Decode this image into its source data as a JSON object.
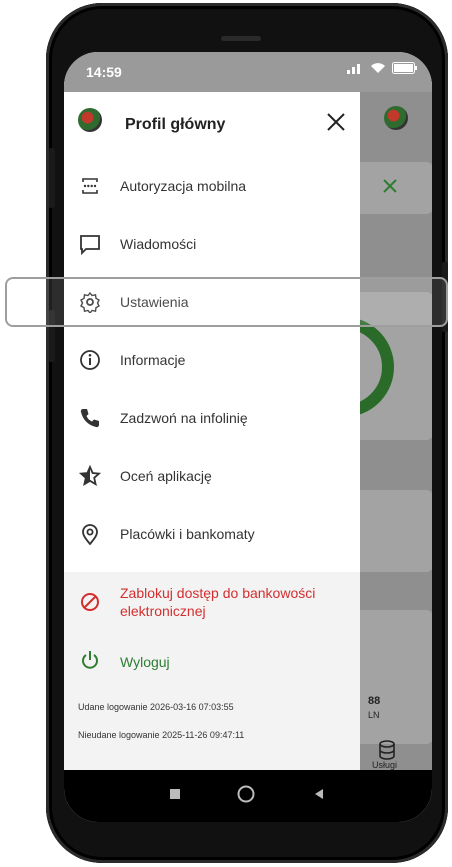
{
  "status_bar": {
    "time": "14:59"
  },
  "drawer": {
    "title": "Profil główny",
    "menu": [
      {
        "label": "Autoryzacja mobilna",
        "icon": "mobile-authorization-icon"
      },
      {
        "label": "Wiadomości",
        "icon": "message-icon"
      },
      {
        "label": "Ustawienia",
        "icon": "gear-icon"
      },
      {
        "label": "Informacje",
        "icon": "info-icon"
      },
      {
        "label": "Zadzwoń na infolinię",
        "icon": "phone-icon"
      },
      {
        "label": "Oceń aplikację",
        "icon": "star-icon"
      },
      {
        "label": "Placówki i bankomaty",
        "icon": "location-pin-icon"
      }
    ],
    "block_access": "Zablokuj dostęp do bankowości elektronicznej",
    "logout": "Wyloguj",
    "last_login_success": "Udane logowanie 2026-03-16 07:03:55",
    "last_login_failed": "Nieudane logowanie 2025-11-26 09:47:11"
  },
  "background": {
    "amount_fragment": "88",
    "currency_fragment": "LN",
    "nav_label": "Usługi"
  },
  "colors": {
    "danger": "#d32f2f",
    "success": "#2e7d32",
    "overlay": "#8f8f8f"
  }
}
